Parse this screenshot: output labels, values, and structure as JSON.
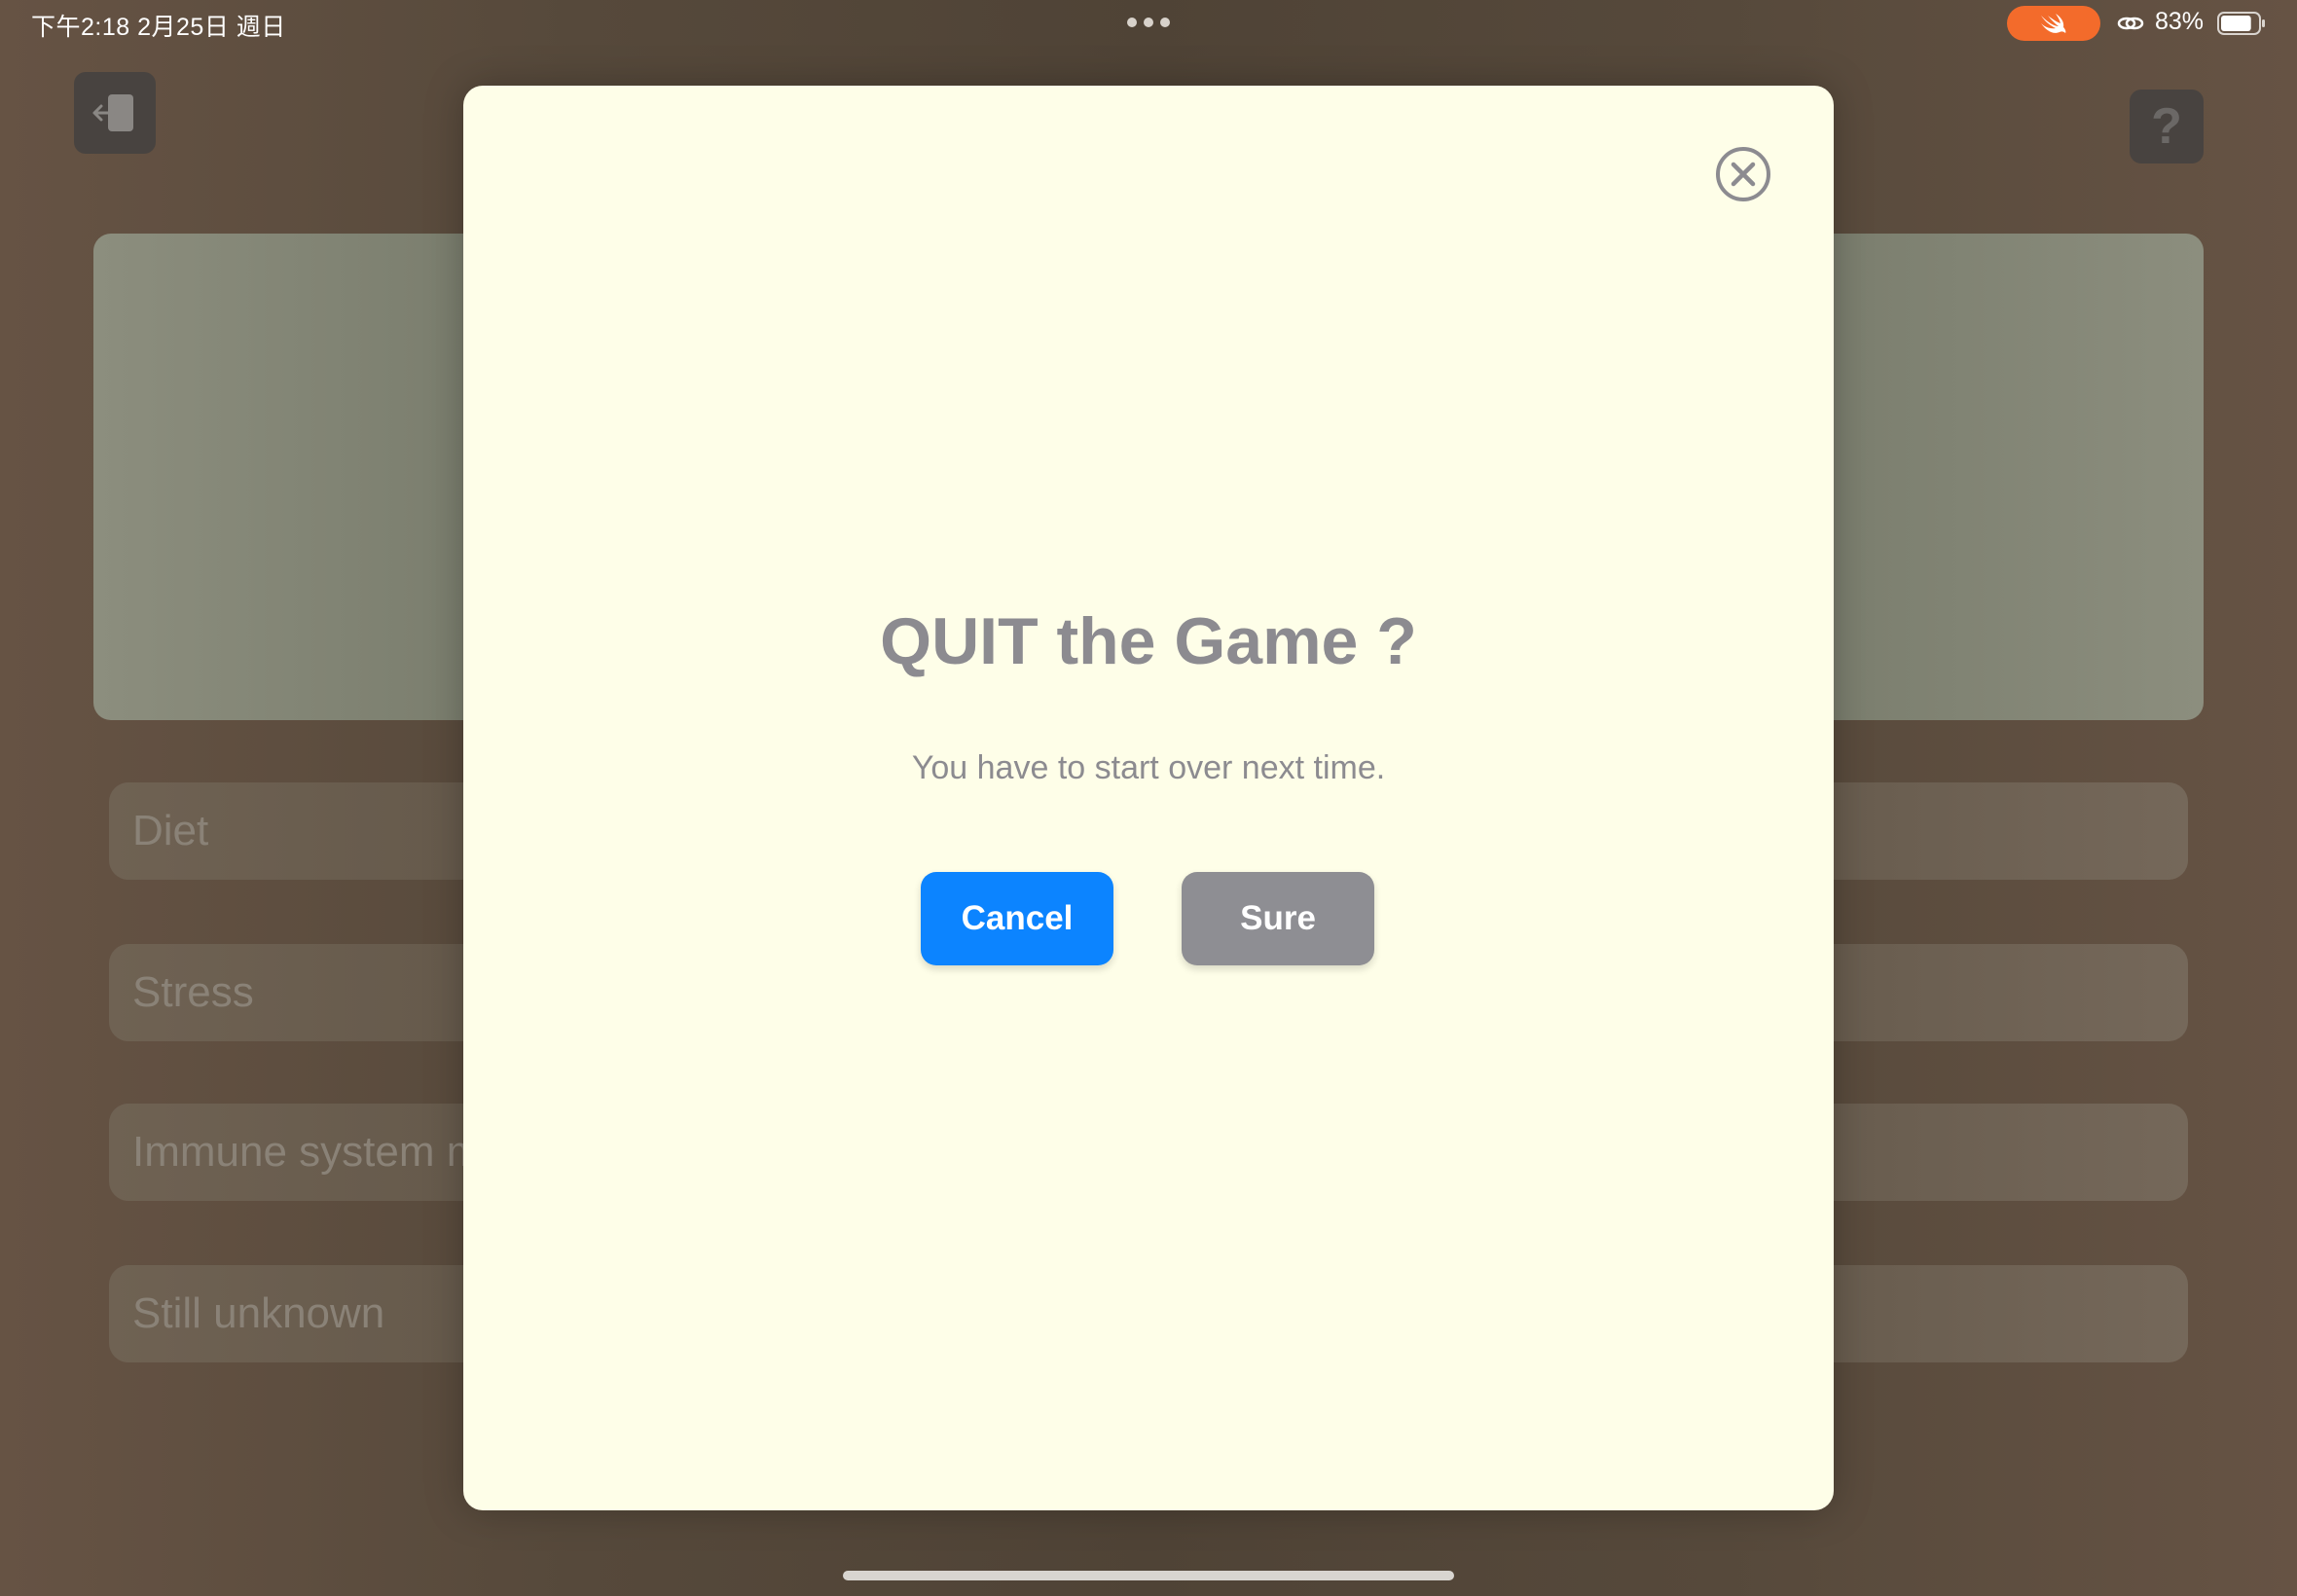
{
  "status_bar": {
    "time_date": "下午2:18   2月25日 週日",
    "battery_percent": "83%",
    "battery_level": 0.83,
    "swift_pill_color": "#f36b2b"
  },
  "toolbar": {
    "exit_icon": "exit-door-icon",
    "help_label": "?"
  },
  "answers": [
    {
      "label": "Diet"
    },
    {
      "label": "Stress"
    },
    {
      "label": "Immune system m"
    },
    {
      "label": "Still unknown"
    }
  ],
  "dialog": {
    "title": "QUIT the Game ?",
    "message": "You have to start over next time.",
    "cancel_label": "Cancel",
    "confirm_label": "Sure",
    "close_icon": "close-circle-icon",
    "background_color": "#fefee8",
    "cancel_color": "#0c84ff",
    "confirm_color": "#8e8e93"
  }
}
